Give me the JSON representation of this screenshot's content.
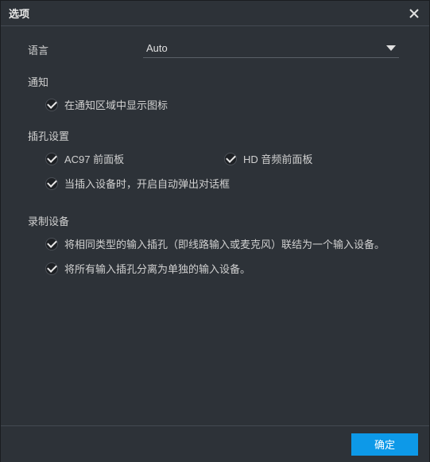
{
  "title": "选项",
  "language": {
    "label": "语言",
    "value": "Auto"
  },
  "notification": {
    "title": "通知",
    "show_tray_icon": "在通知区域中显示图标"
  },
  "jack": {
    "title": "插孔设置",
    "ac97": "AC97 前面板",
    "hd_audio": "HD 音频前面板",
    "auto_popup": "当插入设备时，开启自动弹出对话框"
  },
  "recording": {
    "title": "录制设备",
    "tie_same_type": "将相同类型的输入插孔（即线路输入或麦克风）联结为一个输入设备。",
    "separate_all": "将所有输入插孔分离为单独的输入设备。"
  },
  "footer": {
    "ok": "确定"
  }
}
